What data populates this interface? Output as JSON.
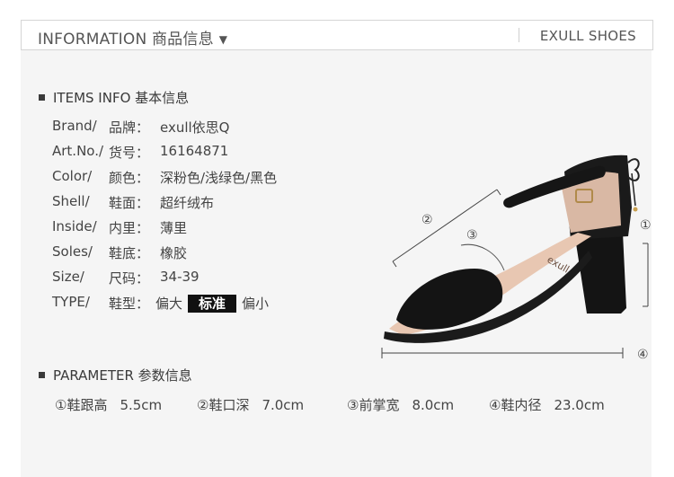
{
  "header": {
    "title": "INFORMATION 商品信息",
    "arrow": "▼",
    "brand": "EXULL SHOES"
  },
  "items_section": {
    "title": "ITEMS INFO 基本信息",
    "rows": [
      {
        "en": "Brand/",
        "cn": "品牌：",
        "value": "exull依思Q"
      },
      {
        "en": "Art.No./",
        "cn": "货号：",
        "value": "16164871"
      },
      {
        "en": "Color/",
        "cn": "颜色：",
        "value": "深粉色/浅绿色/黑色"
      },
      {
        "en": "Shell/",
        "cn": "鞋面：",
        "value": "超纤绒布"
      },
      {
        "en": "Inside/",
        "cn": "内里：",
        "value": "薄里"
      },
      {
        "en": "Soles/",
        "cn": "鞋底：",
        "value": "橡胶"
      },
      {
        "en": "Size/",
        "cn": "尺码：",
        "value": "34-39"
      }
    ],
    "type_row": {
      "en": "TYPE/",
      "cn": "鞋型：",
      "large": "偏大",
      "standard": "标准",
      "small": "偏小"
    }
  },
  "parameter_section": {
    "title": "PARAMETER 参数信息",
    "params": [
      {
        "label": "①鞋跟高",
        "value": "5.5cm"
      },
      {
        "label": "②鞋口深",
        "value": "7.0cm"
      },
      {
        "label": "③前掌宽",
        "value": "8.0cm"
      },
      {
        "label": "④鞋内径",
        "value": "23.0cm"
      }
    ]
  },
  "diagram": {
    "marker_1": "①",
    "marker_2": "②",
    "marker_3": "③",
    "marker_4": "④",
    "insole_logo": "exull"
  }
}
